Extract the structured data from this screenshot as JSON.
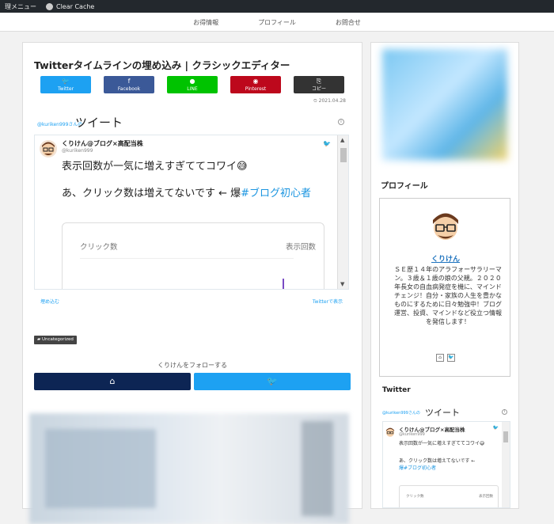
{
  "adminbar": {
    "menu_label": "理メニュー",
    "clear_cache_label": "Clear Cache"
  },
  "nav": {
    "items": [
      "お得情報",
      "プロフィール",
      "お問合せ"
    ]
  },
  "post": {
    "title": "Twitterタイムラインの埋め込み | クラシックエディター",
    "share": [
      {
        "label": "Twitter",
        "icon": "twitter-icon",
        "glyph": "🐦",
        "color": "#1da1f2"
      },
      {
        "label": "Facebook",
        "icon": "facebook-icon",
        "glyph": "f",
        "color": "#3b5998"
      },
      {
        "label": "LINE",
        "icon": "line-icon",
        "glyph": "●",
        "color": "#00c300"
      },
      {
        "label": "Pinterest",
        "icon": "pinterest-icon",
        "glyph": "◉",
        "color": "#bd081c"
      },
      {
        "label": "コピー",
        "icon": "copy-icon",
        "glyph": "⎘",
        "color": "#333333"
      }
    ],
    "date": "⏲ 2021.04.28",
    "category": "Uncategorized",
    "follow_text": "くりけんをフォローする",
    "follow_home_glyph": "⌂",
    "follow_twitter_glyph": "🐦"
  },
  "timeline": {
    "by": "@kuriken999さんの",
    "heading": "ツイート",
    "info_glyph": "i",
    "tweet": {
      "name": "くりけん@ブログ×高配当株",
      "handle": "@kuriken999",
      "text1": "表示回数が一気に増えすぎててコワイ😅",
      "text2_prefix": "あ、クリック数は増えてないです ← 爆",
      "text2_tag": "#ブログ初心者",
      "card_label_left": "クリック数",
      "card_label_right": "表示回数"
    },
    "embed_label": "埋め込む",
    "view_on_twitter": "Twitterで表示"
  },
  "sidebar": {
    "profile_heading": "プロフィール",
    "profile_name": "くりけん",
    "profile_desc": "ＳＥ歴１４年のアラフォーサラリーマン。３歳＆１歳の娘の父親。２０２０年長女の自血病発症を機に、マインドチェンジ！自分・家族の人生を豊かなものにするために日々勉強中！ブログ運営、投資、マインドなど役立つ情報を発信します！",
    "home_glyph": "⌂",
    "twitter_glyph": "🐦",
    "twitter_heading": "Twitter",
    "tw_by": "@kuriken999さんの",
    "tw_heading": "ツイート",
    "tw_name": "くりけん@ブログ×高配当株",
    "tw_handle": "@kuriken999",
    "tw_text1": "表示回数が一気に増えすぎててコワイ😅",
    "tw_text2": "あ、クリック数は増えてないです ←",
    "tw_text3": "爆#ブログ初心者",
    "tw_card_left": "クリック数",
    "tw_card_right": "表示回数"
  }
}
